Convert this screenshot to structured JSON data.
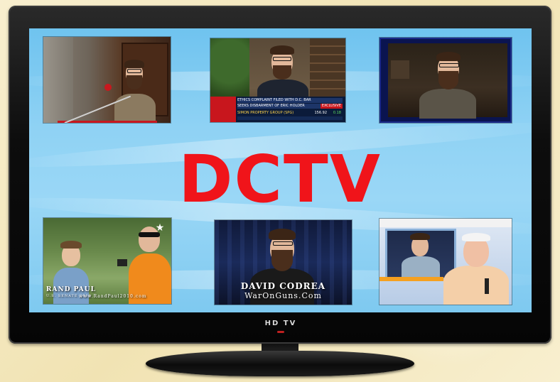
{
  "title": "DCTV",
  "tv_brand_label": "HD TV",
  "thumbnails": [
    {
      "name": "podium-speech",
      "captions": []
    },
    {
      "name": "news-interview",
      "captions": [
        "ETHICS COMPLAINT FILED WITH D.C. BAR",
        "SEEKS DISBARMENT OF ERIC HOLDER",
        "EXCLUSIVE",
        "SIMON PROPERTY GROUP (SPG)",
        "156.92",
        "0.18"
      ]
    },
    {
      "name": "webcam-interview",
      "captions": []
    },
    {
      "name": "rand-paul-interview",
      "captions": [
        "RAND PAUL",
        "U.S. SENATE 2010",
        "www.RandPaul2010.com"
      ]
    },
    {
      "name": "david-codrea",
      "captions": [
        "DAVID CODREA",
        "WarOnGuns.Com"
      ]
    },
    {
      "name": "talk-show-split",
      "captions": []
    }
  ],
  "colors": {
    "title_red": "#f0141a",
    "screen_sky": "#8fd2f4",
    "background_cream": "#f6ecc6",
    "bezel_black": "#0d0d0d"
  }
}
